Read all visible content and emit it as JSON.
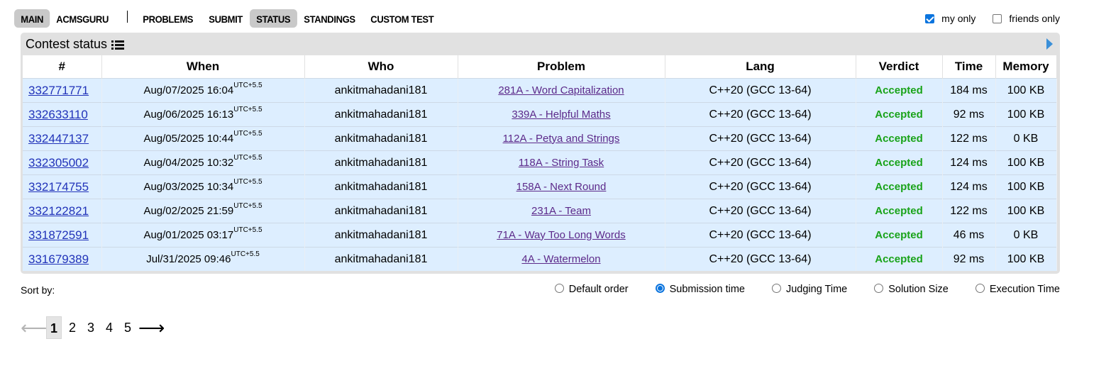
{
  "nav": {
    "tabs": [
      "MAIN",
      "ACMSGURU",
      "PROBLEMS",
      "SUBMIT",
      "STATUS",
      "STANDINGS",
      "CUSTOM TEST"
    ]
  },
  "filters": {
    "my_only": "my only",
    "friends_only": "friends only"
  },
  "box": {
    "title": "Contest status"
  },
  "table": {
    "headers": [
      "#",
      "When",
      "Who",
      "Problem",
      "Lang",
      "Verdict",
      "Time",
      "Memory"
    ],
    "tz": "UTC+5.5",
    "rows": [
      {
        "id": "332771771",
        "when": "Aug/07/2025 16:04",
        "who": "ankitmahadani181",
        "problem": "281A - Word Capitalization",
        "lang": "C++20 (GCC 13-64)",
        "verdict": "Accepted",
        "time": "184 ms",
        "memory": "100 KB"
      },
      {
        "id": "332633110",
        "when": "Aug/06/2025 16:13",
        "who": "ankitmahadani181",
        "problem": "339A - Helpful Maths",
        "lang": "C++20 (GCC 13-64)",
        "verdict": "Accepted",
        "time": "92 ms",
        "memory": "100 KB"
      },
      {
        "id": "332447137",
        "when": "Aug/05/2025 10:44",
        "who": "ankitmahadani181",
        "problem": "112A - Petya and Strings",
        "lang": "C++20 (GCC 13-64)",
        "verdict": "Accepted",
        "time": "122 ms",
        "memory": "0 KB"
      },
      {
        "id": "332305002",
        "when": "Aug/04/2025 10:32",
        "who": "ankitmahadani181",
        "problem": "118A - String Task",
        "lang": "C++20 (GCC 13-64)",
        "verdict": "Accepted",
        "time": "124 ms",
        "memory": "100 KB"
      },
      {
        "id": "332174755",
        "when": "Aug/03/2025 10:34",
        "who": "ankitmahadani181",
        "problem": "158A - Next Round",
        "lang": "C++20 (GCC 13-64)",
        "verdict": "Accepted",
        "time": "124 ms",
        "memory": "100 KB"
      },
      {
        "id": "332122821",
        "when": "Aug/02/2025 21:59",
        "who": "ankitmahadani181",
        "problem": "231A - Team",
        "lang": "C++20 (GCC 13-64)",
        "verdict": "Accepted",
        "time": "122 ms",
        "memory": "100 KB"
      },
      {
        "id": "331872591",
        "when": "Aug/01/2025 03:17",
        "who": "ankitmahadani181",
        "problem": "71A - Way Too Long Words",
        "lang": "C++20 (GCC 13-64)",
        "verdict": "Accepted",
        "time": "46 ms",
        "memory": "0 KB"
      },
      {
        "id": "331679389",
        "when": "Jul/31/2025 09:46",
        "who": "ankitmahadani181",
        "problem": "4A - Watermelon",
        "lang": "C++20 (GCC 13-64)",
        "verdict": "Accepted",
        "time": "92 ms",
        "memory": "100 KB"
      }
    ]
  },
  "sort": {
    "label": "Sort by:",
    "options": [
      "Default order",
      "Submission time",
      "Judging Time",
      "Solution Size",
      "Execution Time"
    ]
  },
  "pagination": {
    "prev": "⟵",
    "next": "⟶",
    "pages": [
      "1",
      "2",
      "3",
      "4",
      "5"
    ]
  },
  "colors": {
    "accepted": "#19a319",
    "row_bg": "#ddeeff",
    "box_bg": "#e1e1e1",
    "checkbox": "#0b74de"
  }
}
